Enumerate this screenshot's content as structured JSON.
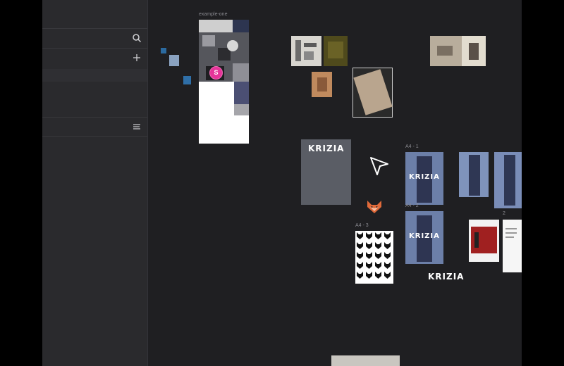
{
  "sidebar": {
    "search_icon": "search-icon",
    "add_icon": "plus-icon",
    "filter_icon": "sliders-icon"
  },
  "canvas": {
    "frames": {
      "example_one": "example-one",
      "a4_1": "A4 - 1",
      "a4_2": "A4 - 2",
      "a4_3": "A4 - 3",
      "frame_2": "2"
    },
    "logo_text": "KRIZIA",
    "avatar_initial": "S",
    "avatar_color": "#e6359a",
    "fox_color": "#e06a3a"
  }
}
